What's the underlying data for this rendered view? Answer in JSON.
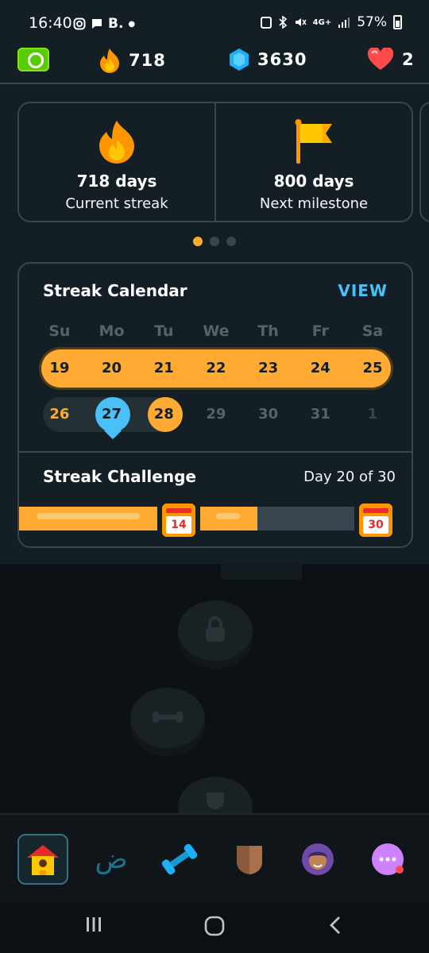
{
  "status_bar": {
    "time": "16:40",
    "notification_letter": "B.",
    "battery": "57%",
    "network": "4G+"
  },
  "top_stats": {
    "streak_count": "718",
    "gems_count": "3630",
    "hearts_count": "2"
  },
  "streak_cards": [
    {
      "value": "718 days",
      "label": "Current streak",
      "icon": "flame-icon"
    },
    {
      "value": "800 days",
      "label": "Next milestone",
      "icon": "flag-icon"
    }
  ],
  "carousel": {
    "pages": 3,
    "active": 1
  },
  "calendar": {
    "title": "Streak Calendar",
    "view_label": "VIEW",
    "weekdays": [
      "Su",
      "Mo",
      "Tu",
      "We",
      "Th",
      "Fr",
      "Sa"
    ],
    "week1": [
      "19",
      "20",
      "21",
      "22",
      "23",
      "24",
      "25"
    ],
    "week2": [
      "26",
      "27",
      "28",
      "29",
      "30",
      "31",
      "1"
    ]
  },
  "challenge": {
    "title": "Streak Challenge",
    "progress_text": "Day 20 of 30",
    "milestone1": "14",
    "milestone2": "30",
    "current_day": 20,
    "total_days": 30
  },
  "colors": {
    "background": "#131f24",
    "border": "#37464f",
    "streak_orange": "#ffab33",
    "accent_blue": "#49c0f8",
    "muted": "#52656d"
  },
  "nav": [
    "home-icon",
    "letters-icon",
    "practice-icon",
    "leagues-icon",
    "profile-icon",
    "more-icon"
  ]
}
